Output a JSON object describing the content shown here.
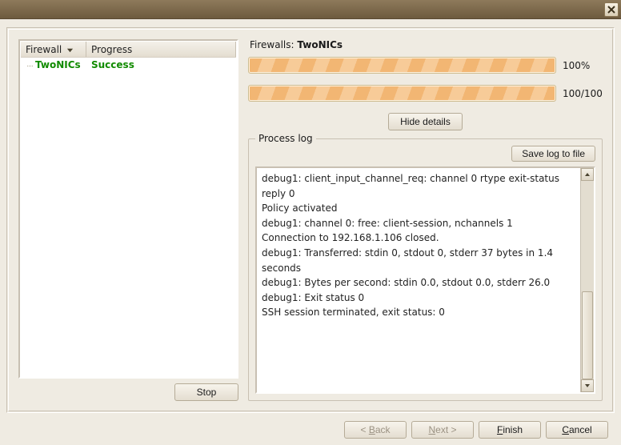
{
  "titlebar": {
    "close_name": "close"
  },
  "left": {
    "col_firewall": "Firewall",
    "col_progress": "Progress",
    "rows": [
      {
        "name": "TwoNICs",
        "status": "Success"
      }
    ],
    "stop_label": "Stop"
  },
  "right": {
    "firewalls_label": "Firewalls:",
    "firewalls_name": "TwoNICs",
    "progress1_text": "100%",
    "progress2_text": "100/100",
    "hide_details_label": "Hide details",
    "process_log_legend": "Process log",
    "save_log_label": "Save log to file",
    "log_lines": [
      "debug1: client_input_channel_req: channel 0 rtype exit-status reply 0",
      "Policy activated",
      "debug1: channel 0: free: client-session, nchannels 1",
      "Connection to 192.168.1.106 closed.",
      "debug1: Transferred: stdin 0, stdout 0, stderr 37 bytes in 1.4 seconds",
      "debug1: Bytes per second: stdin 0.0, stdout 0.0, stderr 26.0",
      "debug1: Exit status 0",
      "SSH session terminated, exit status: 0"
    ]
  },
  "footer": {
    "back_pre": "< ",
    "back_u": "B",
    "back_post": "ack",
    "next_u": "N",
    "next_post": "ext >",
    "finish_u": "F",
    "finish_post": "inish",
    "cancel_u": "C",
    "cancel_post": "ancel"
  }
}
